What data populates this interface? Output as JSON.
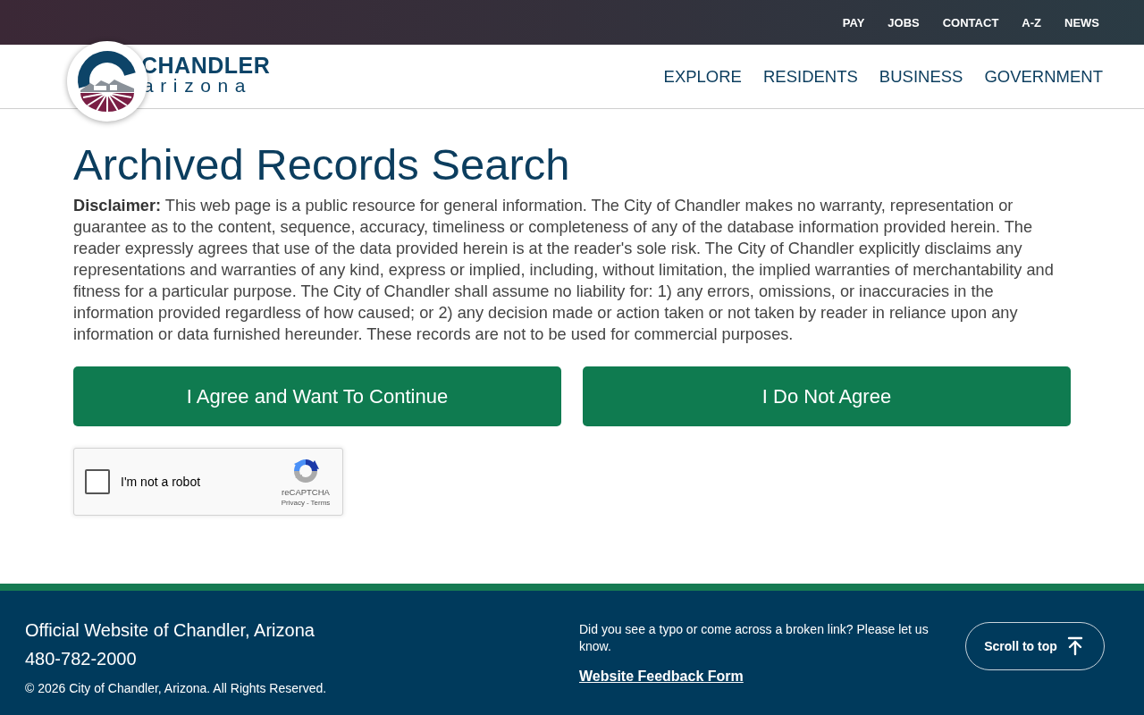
{
  "top_links": [
    "PAY",
    "JOBS",
    "CONTACT",
    "A-Z",
    "NEWS"
  ],
  "logo": {
    "name": "CHANDLER",
    "subtitle": "arizona"
  },
  "main_nav": [
    "EXPLORE",
    "RESIDENTS",
    "BUSINESS",
    "GOVERNMENT"
  ],
  "page": {
    "title": "Archived Records Search",
    "disclaimer": "**Disclaimer:** This web page is a public resource for general information. The City of Chandler makes no warranty, representation or guarantee as to the content, sequence, accuracy, timeliness or completeness of any of the database information provided herein. The reader expressly agrees that use of the data provided herein is at the reader's sole risk. The City of Chandler explicitly disclaims any representations and warranties of any kind, express or implied, including, without limitation, the implied warranties of merchantability and fitness for a particular purpose. The City of Chandler shall assume no liability for: 1) any errors, omissions, or inaccuracies in the information provided regardless of how caused; or 2) any decision made or action taken or not taken by reader in reliance upon any information or data furnished hereunder. These records are not to be used for commercial purposes."
  },
  "buttons": [
    "I Agree and Want To Continue",
    "I Do Not Agree"
  ],
  "captcha": {
    "checked": false,
    "label": "I'm not a robot",
    "brand": "reCAPTCHA",
    "links": [
      "Privacy",
      "Terms"
    ],
    "separator": "-"
  },
  "footer": {
    "site_name": "Official Website of Chandler, Arizona",
    "phone": "480-782-2000",
    "copyright": "© 2026 City of Chandler, Arizona. All Rights Reserved.",
    "feedback_prompt": "Did you see a typo or come across a broken link? Please let us know.",
    "feedback_link": "Website Feedback Form",
    "scroll_button": "Scroll to top"
  }
}
